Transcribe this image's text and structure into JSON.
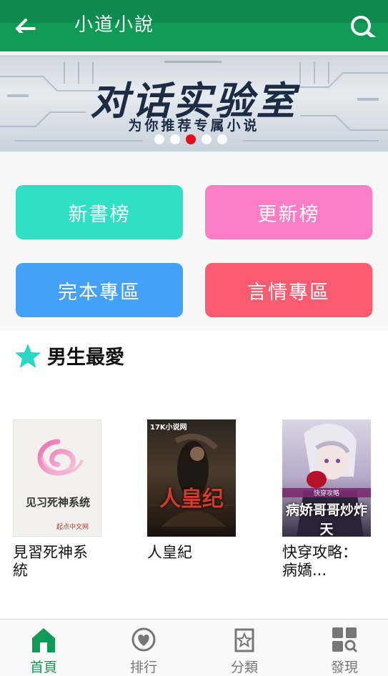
{
  "header": {
    "title": "小道小說",
    "back_icon": "arrow-left-icon",
    "search_icon": "search-icon",
    "color": "#0f9b56"
  },
  "banner": {
    "headline": "对话实验室",
    "subtitle": "为你推荐专属小说",
    "dots_total": 5,
    "active_dot": 3,
    "active_dot_color": "#e3101a"
  },
  "categories": [
    {
      "label": "新書榜",
      "color": "#2fe0c4"
    },
    {
      "label": "更新榜",
      "color": "#fb7dc6"
    },
    {
      "label": "完本專區",
      "color": "#43a2f8"
    },
    {
      "label": "言情專區",
      "color": "#fb5b6f"
    }
  ],
  "section": {
    "title": "男生最愛",
    "icon": "star-icon",
    "icon_color": "#2ad6c5"
  },
  "books": [
    {
      "title": "見習死神系統",
      "cover_text": "见习死神系统",
      "cover_imprint": "起点中文网"
    },
    {
      "title": "人皇紀",
      "cover_text": "人皇纪",
      "cover_imprint": "17K小说网"
    },
    {
      "title": "快穿攻略：病嬌...",
      "cover_text": "病娇哥哥炒炸天",
      "cover_imprint": "快穿攻略"
    }
  ],
  "tabs": [
    {
      "label": "首頁",
      "icon": "home-icon",
      "active": true
    },
    {
      "label": "排行",
      "icon": "heart-icon",
      "active": false
    },
    {
      "label": "分類",
      "icon": "bookmark-star-icon",
      "active": false
    },
    {
      "label": "發現",
      "icon": "grid-search-icon",
      "active": false
    }
  ]
}
